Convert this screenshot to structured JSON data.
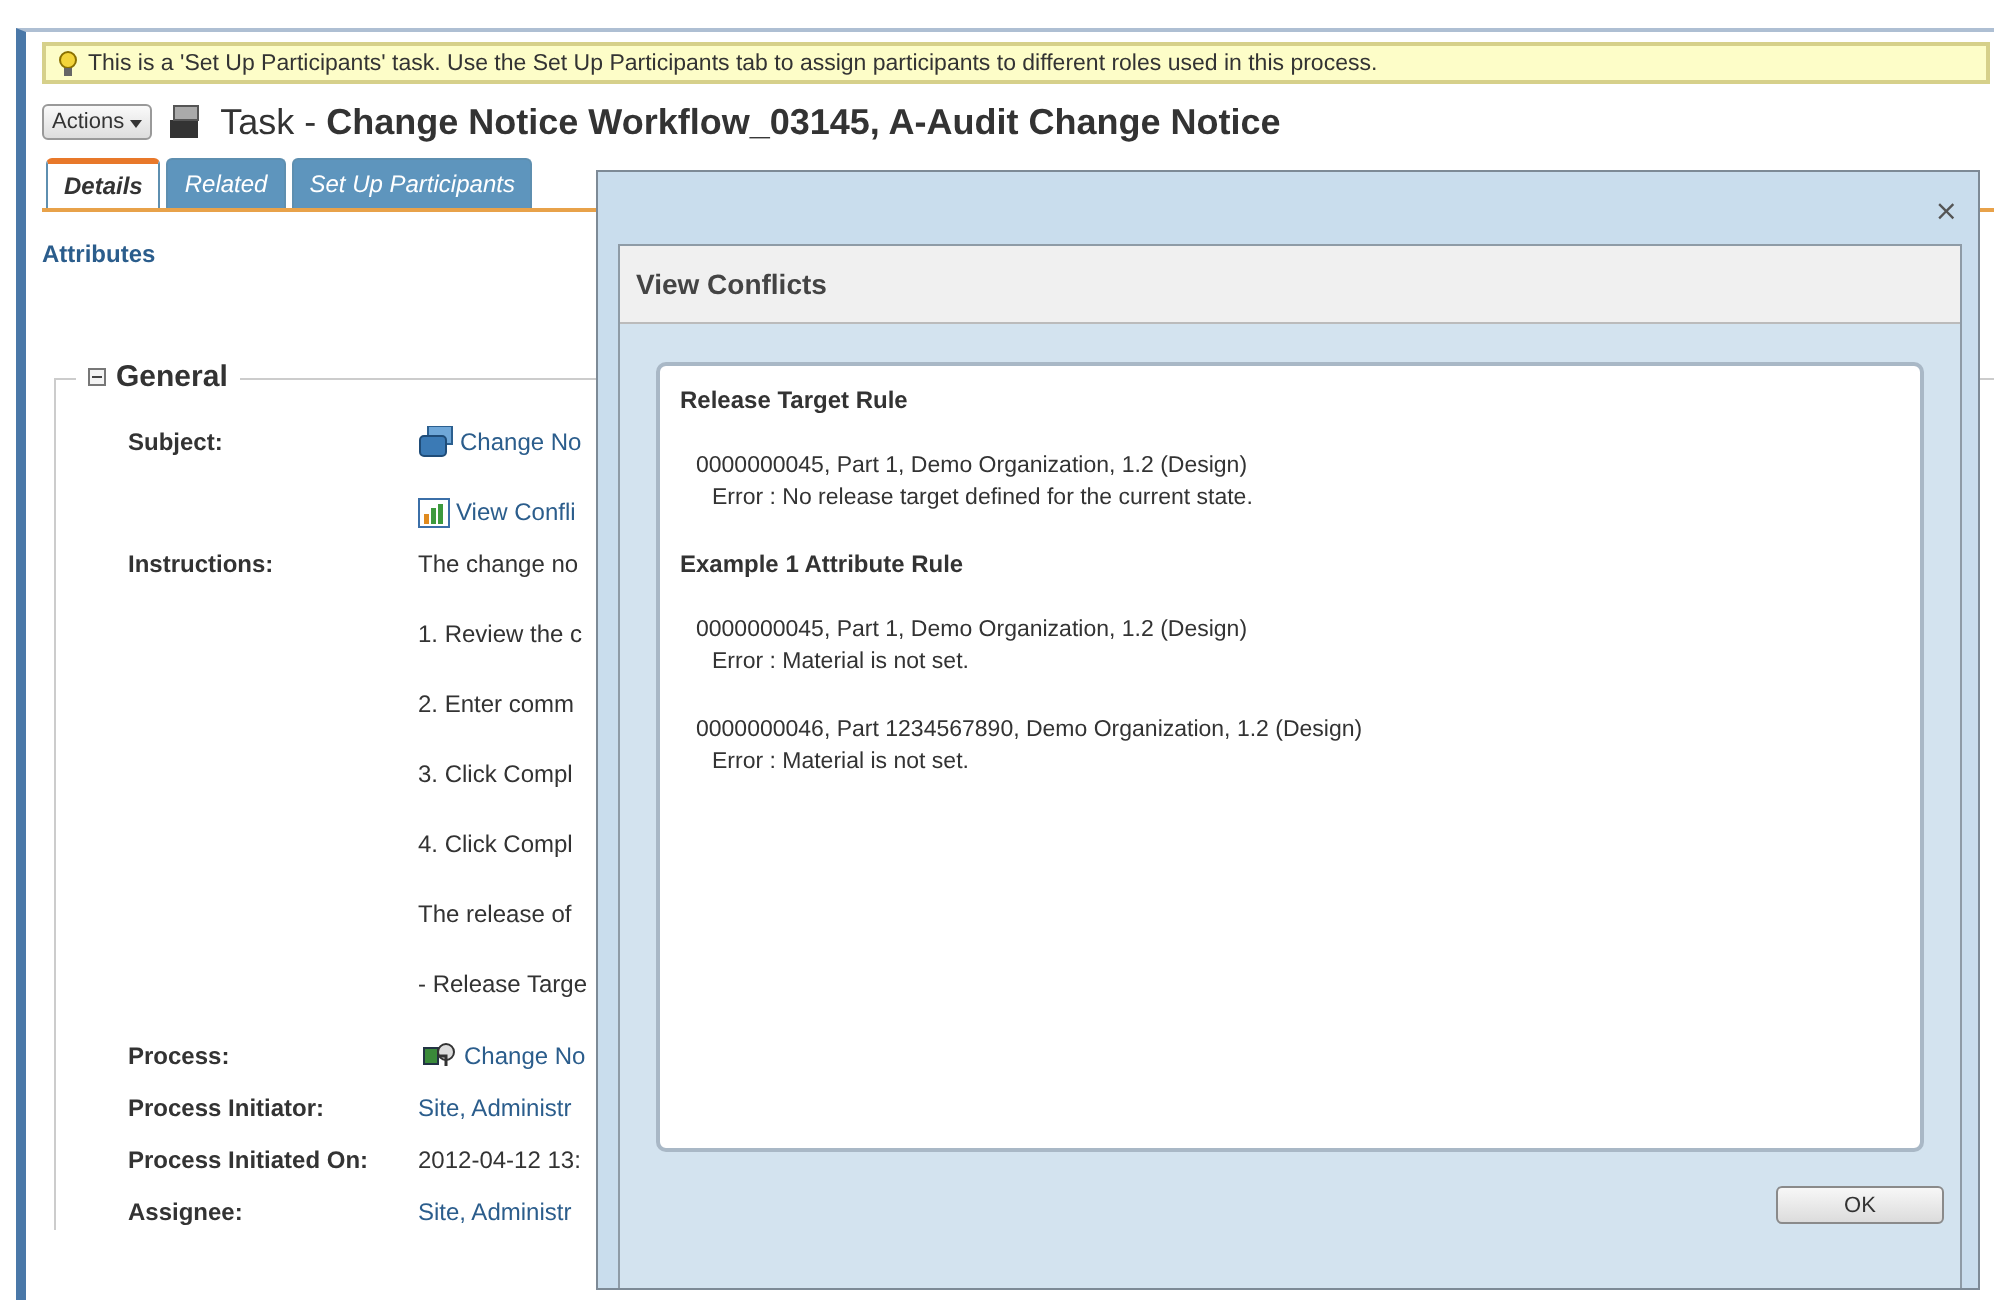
{
  "notice": {
    "text": "This is a 'Set Up Participants' task. Use the Set Up Participants tab to assign participants to different roles used in this process."
  },
  "header": {
    "actions_button": "Actions",
    "title": "Task - **Change Notice Workflow_03145, A-Audit Change Notice**"
  },
  "tabs": [
    {
      "label": "Details",
      "selected": true
    },
    {
      "label": "Related",
      "selected": false
    },
    {
      "label": "Set Up Participants",
      "selected": false
    }
  ],
  "section_link": "Attributes",
  "general": {
    "title": "General",
    "expanded": true,
    "fields": [
      {
        "label": "Subject:",
        "values": [
          {
            "kind": "subject-link",
            "text": "Change No"
          },
          {
            "kind": "conflicts-link",
            "text": "View Confli"
          }
        ]
      },
      {
        "label": "Instructions:",
        "values": [
          {
            "kind": "text",
            "text": "The change no"
          },
          {
            "kind": "text",
            "text": "1. Review the c"
          },
          {
            "kind": "text",
            "text": "2. Enter comm"
          },
          {
            "kind": "text",
            "text": "3. Click Compl"
          },
          {
            "kind": "text",
            "text": "4. Click Compl"
          },
          {
            "kind": "text",
            "text": "The release of"
          },
          {
            "kind": "text",
            "text": "- Release Targe"
          }
        ]
      },
      {
        "label": "Process:",
        "values": [
          {
            "kind": "process-link",
            "text": "Change No"
          }
        ]
      },
      {
        "label": "Process Initiator:",
        "values": [
          {
            "kind": "link",
            "text": "Site, Administr"
          }
        ]
      },
      {
        "label": "Process Initiated On:",
        "values": [
          {
            "kind": "text",
            "text": "2012-04-12 13:"
          }
        ]
      },
      {
        "label": "Assignee:",
        "values": [
          {
            "kind": "link",
            "text": "Site, Administr"
          }
        ]
      }
    ]
  },
  "dialog": {
    "close": "×",
    "title": "View Conflicts",
    "rules": [
      {
        "name": "Release Target Rule",
        "items": [
          {
            "object": "0000000045, Part 1, Demo Organization, 1.2 (Design)",
            "error": "Error : No release target defined for the current state."
          }
        ]
      },
      {
        "name": "Example 1 Attribute Rule",
        "items": [
          {
            "object": "0000000045, Part 1, Demo Organization, 1.2 (Design)",
            "error": "Error : Material is not set."
          },
          {
            "object": "0000000046, Part 1234567890, Demo Organization, 1.2 (Design)",
            "error": "Error : Material is not set."
          }
        ]
      }
    ],
    "ok_button": "OK"
  }
}
